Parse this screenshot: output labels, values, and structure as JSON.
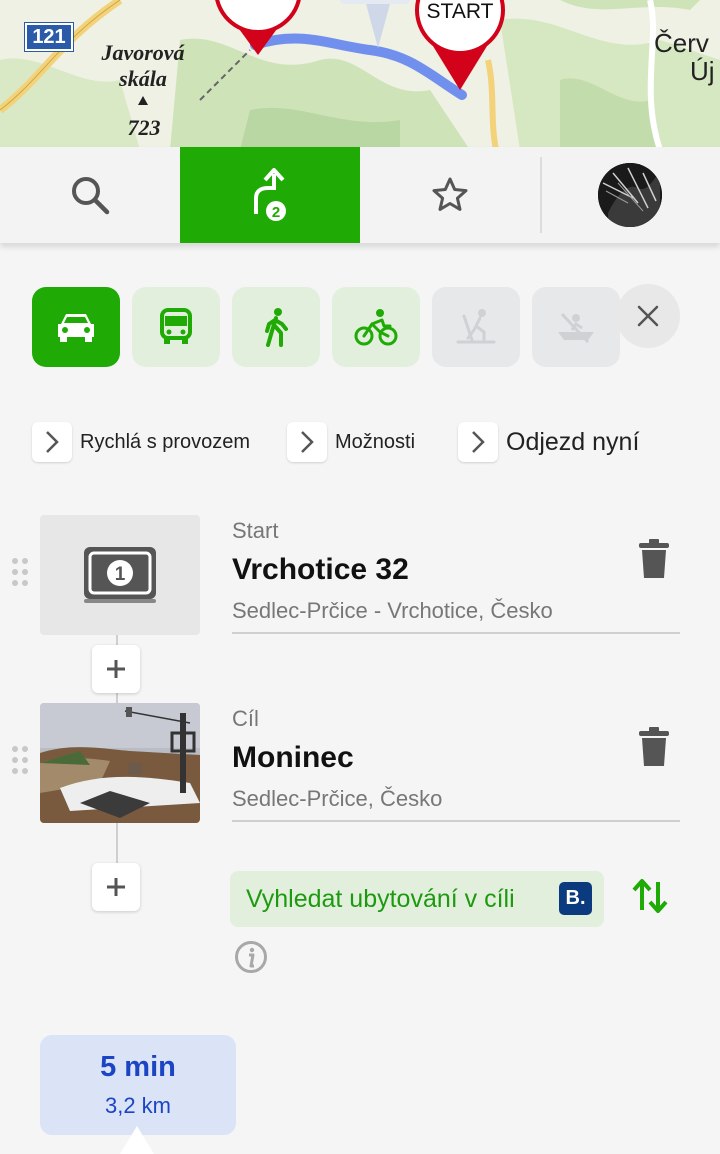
{
  "map": {
    "road_number": "121",
    "place_name_1": "Javorová",
    "place_name_2": "skála",
    "elevation": "723",
    "start_marker_label": "START",
    "edge_label_1": "Červ",
    "edge_label_2": "Új"
  },
  "topnav": {
    "items": [
      {
        "name": "search",
        "icon": "search-icon"
      },
      {
        "name": "route",
        "icon": "route-icon",
        "badge": "2",
        "active": true
      },
      {
        "name": "favorites",
        "icon": "star-icon"
      },
      {
        "name": "profile",
        "icon": "avatar"
      }
    ]
  },
  "modes": [
    {
      "name": "car",
      "icon": "car-icon",
      "state": "active"
    },
    {
      "name": "public-transport",
      "icon": "bus-icon",
      "state": "available"
    },
    {
      "name": "walk",
      "icon": "walk-icon",
      "state": "available"
    },
    {
      "name": "bike",
      "icon": "bike-icon",
      "state": "available"
    },
    {
      "name": "ski",
      "icon": "ski-icon",
      "state": "disabled"
    },
    {
      "name": "boat",
      "icon": "canoe-icon",
      "state": "disabled"
    }
  ],
  "options": {
    "route_type": "Rychlá s provozem",
    "settings": "Možnosti",
    "departure": "Odjezd nyní"
  },
  "waypoints": [
    {
      "kind": "Start",
      "name": "Vrchotice 32",
      "address": "Sedlec-Prčice - Vrchotice, Česko",
      "badge_number": "1"
    },
    {
      "kind": "Cíl",
      "name": "Moninec",
      "address": "Sedlec-Prčice, Česko"
    }
  ],
  "accommodation": {
    "label": "Vyhledat ubytování v cíli",
    "booking_badge": "B."
  },
  "summary": {
    "time": "5 min",
    "distance": "3,2 km"
  },
  "colors": {
    "accent_green": "#1faa05",
    "light_green": "#e2efdd",
    "route_blue": "#1b45c4"
  }
}
